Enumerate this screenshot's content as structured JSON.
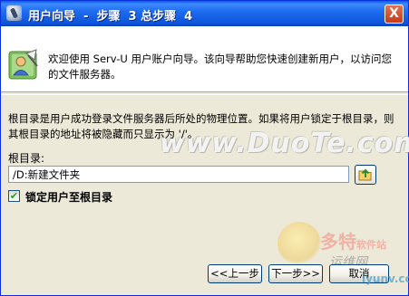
{
  "window": {
    "title": "用户向导  -  步骤  3 总步骤  4",
    "close_label": "X",
    "app_icon": "wizard-icon"
  },
  "header": {
    "text": "欢迎使用  Serv-U 用户账户向导。该向导帮助您快速创建新用户，以访问您的文件服务器。",
    "icon": "user-wizard-icon"
  },
  "body": {
    "description": "根目录是用户成功登录文件服务器后所处的物理位置。如果将用户锁定于根目录，则其根目录的地址将被隐藏而只显示为 '/'。",
    "root_dir_label": "根目录:",
    "root_dir_value": "/D:新建文件夹",
    "browse_icon": "folder-browse-icon",
    "lock_label": "锁定用户至根目录",
    "lock_checked": true,
    "check_mark": "✔"
  },
  "buttons": {
    "back": "<<上一步",
    "next": "下一步>>",
    "cancel": "取消"
  },
  "watermarks": {
    "main": "www.DuoTe.com",
    "brand": "多特",
    "brand_sub": "软件站",
    "site_cn": "运维网",
    "site_url": "iyunv.com"
  }
}
